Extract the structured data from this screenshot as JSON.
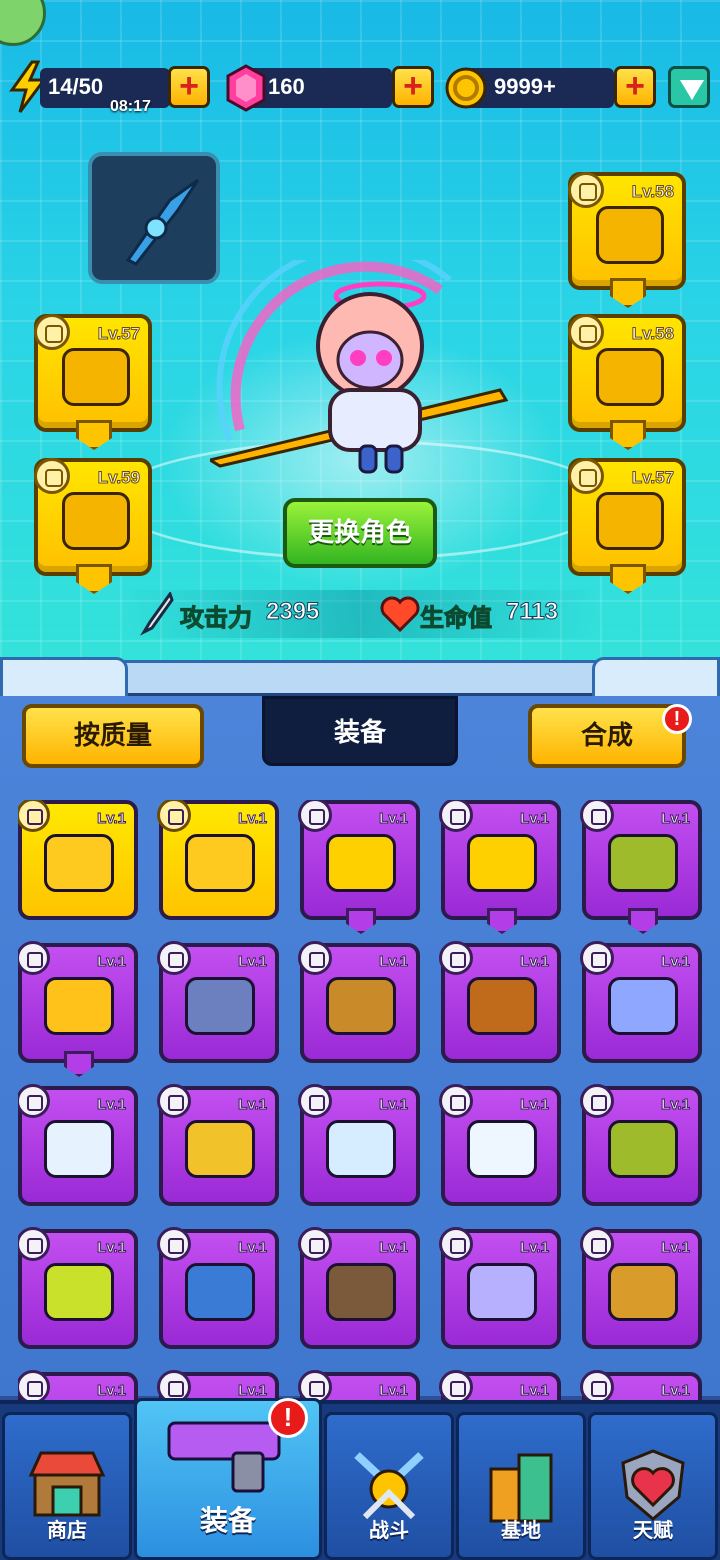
{
  "resources": {
    "energy": "14/50",
    "timer": "08:17",
    "gems": "160",
    "coins": "9999+",
    "plus": "+"
  },
  "hero": {
    "slots": [
      {
        "lv": "Lv.58"
      },
      {
        "lv": "Lv.57"
      },
      {
        "lv": "Lv.58"
      },
      {
        "lv": "Lv.59"
      },
      {
        "lv": "Lv.57"
      }
    ],
    "swap_label": "更换角色",
    "attack_label": "攻击力",
    "attack_value": "2395",
    "hp_label": "生命值",
    "hp_value": "7113"
  },
  "tabs": {
    "quality": "按质量",
    "equip": "装备",
    "merge": "合成",
    "merge_alert": "!"
  },
  "inventory_lv": "Lv.1",
  "nav": {
    "shop": "商店",
    "equip": "装备",
    "battle": "战斗",
    "base": "基地",
    "talent": "天赋",
    "equip_alert": "!"
  },
  "colors": {
    "gold_rarity": "#ffd000",
    "purple_rarity": "#b23fe6",
    "accent_green": "#7cf34a"
  }
}
